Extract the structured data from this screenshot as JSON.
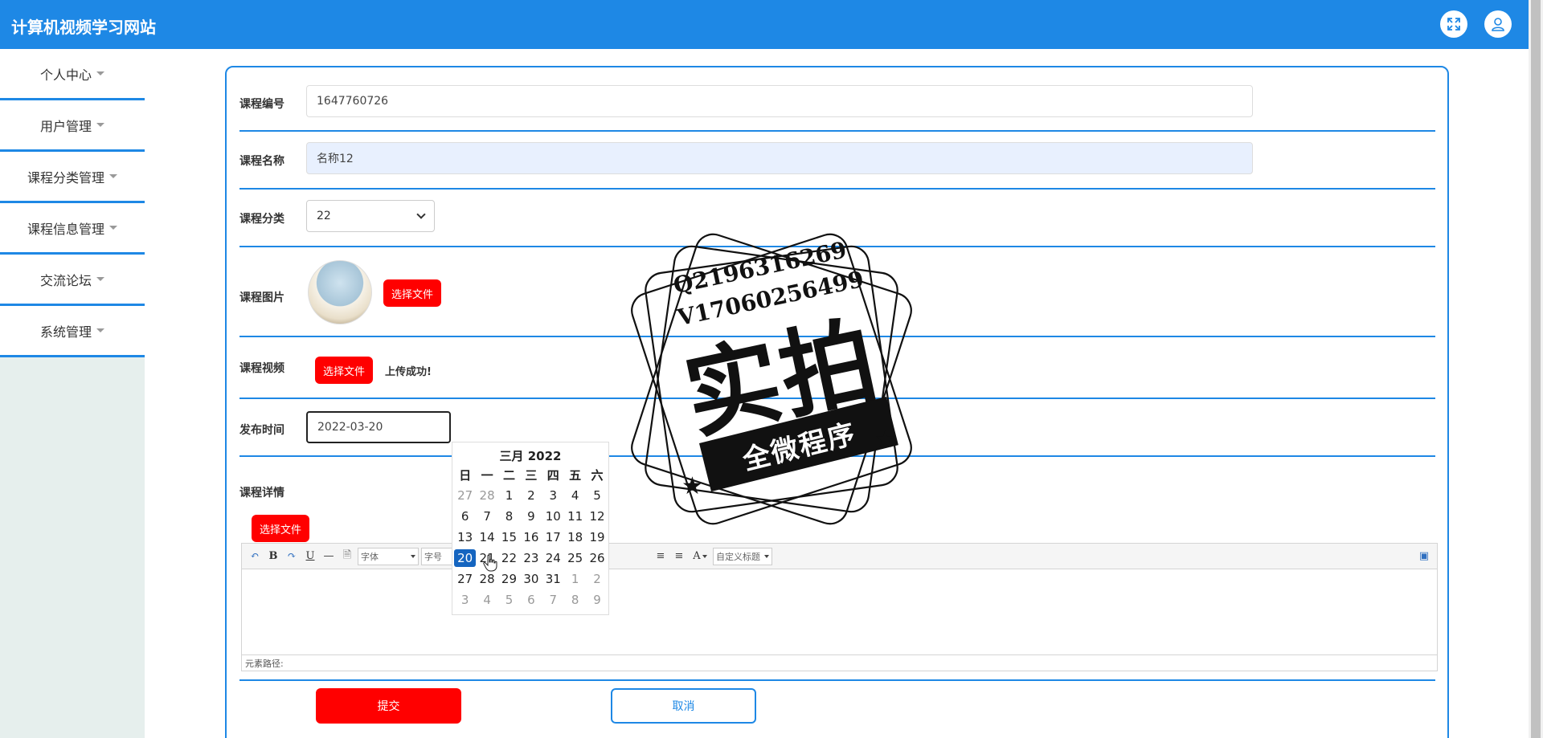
{
  "header": {
    "title": "计算机视频学习网站",
    "fullscreen_icon": "expand-icon",
    "user_icon": "user-icon"
  },
  "sidebar": {
    "items": [
      {
        "label": "个人中心"
      },
      {
        "label": "用户管理"
      },
      {
        "label": "课程分类管理"
      },
      {
        "label": "课程信息管理"
      },
      {
        "label": "交流论坛"
      },
      {
        "label": "系统管理"
      }
    ]
  },
  "form": {
    "course_id": {
      "label": "课程编号",
      "value": "1647760726"
    },
    "course_name": {
      "label": "课程名称",
      "value": "名称12"
    },
    "course_category": {
      "label": "课程分类",
      "selected": "22"
    },
    "course_image": {
      "label": "课程图片",
      "button": "选择文件"
    },
    "course_video": {
      "label": "课程视频",
      "button": "选择文件",
      "status": "上传成功!"
    },
    "publish_time": {
      "label": "发布时间",
      "value": "2022-03-20"
    },
    "course_detail": {
      "label": "课程详情",
      "button": "选择文件"
    },
    "submit_label": "提交",
    "cancel_label": "取消"
  },
  "editor": {
    "font_family_placeholder": "字体",
    "font_size_placeholder": "字号",
    "custom_heading_placeholder": "自定义标题",
    "status_path": "元素路径:",
    "bold": "B",
    "underline": "U",
    "font_color": "A"
  },
  "calendar": {
    "title": "三月 2022",
    "weekdays": [
      "日",
      "一",
      "二",
      "三",
      "四",
      "五",
      "六"
    ],
    "weeks": [
      [
        "27",
        "28",
        "1",
        "2",
        "3",
        "4",
        "5"
      ],
      [
        "6",
        "7",
        "8",
        "9",
        "10",
        "11",
        "12"
      ],
      [
        "13",
        "14",
        "15",
        "16",
        "17",
        "18",
        "19"
      ],
      [
        "20",
        "21",
        "22",
        "23",
        "24",
        "25",
        "26"
      ],
      [
        "27",
        "28",
        "29",
        "30",
        "31",
        "1",
        "2"
      ],
      [
        "3",
        "4",
        "5",
        "6",
        "7",
        "8",
        "9"
      ]
    ],
    "selected": "20"
  },
  "watermark": {
    "qq": "Q2196316269",
    "wechat": "V17060256499",
    "big_text": "实拍",
    "band_text": "全微程序"
  },
  "colors": {
    "accent": "#1e88e5",
    "danger": "#ff0000",
    "sidebar_bg": "#e6efed"
  }
}
